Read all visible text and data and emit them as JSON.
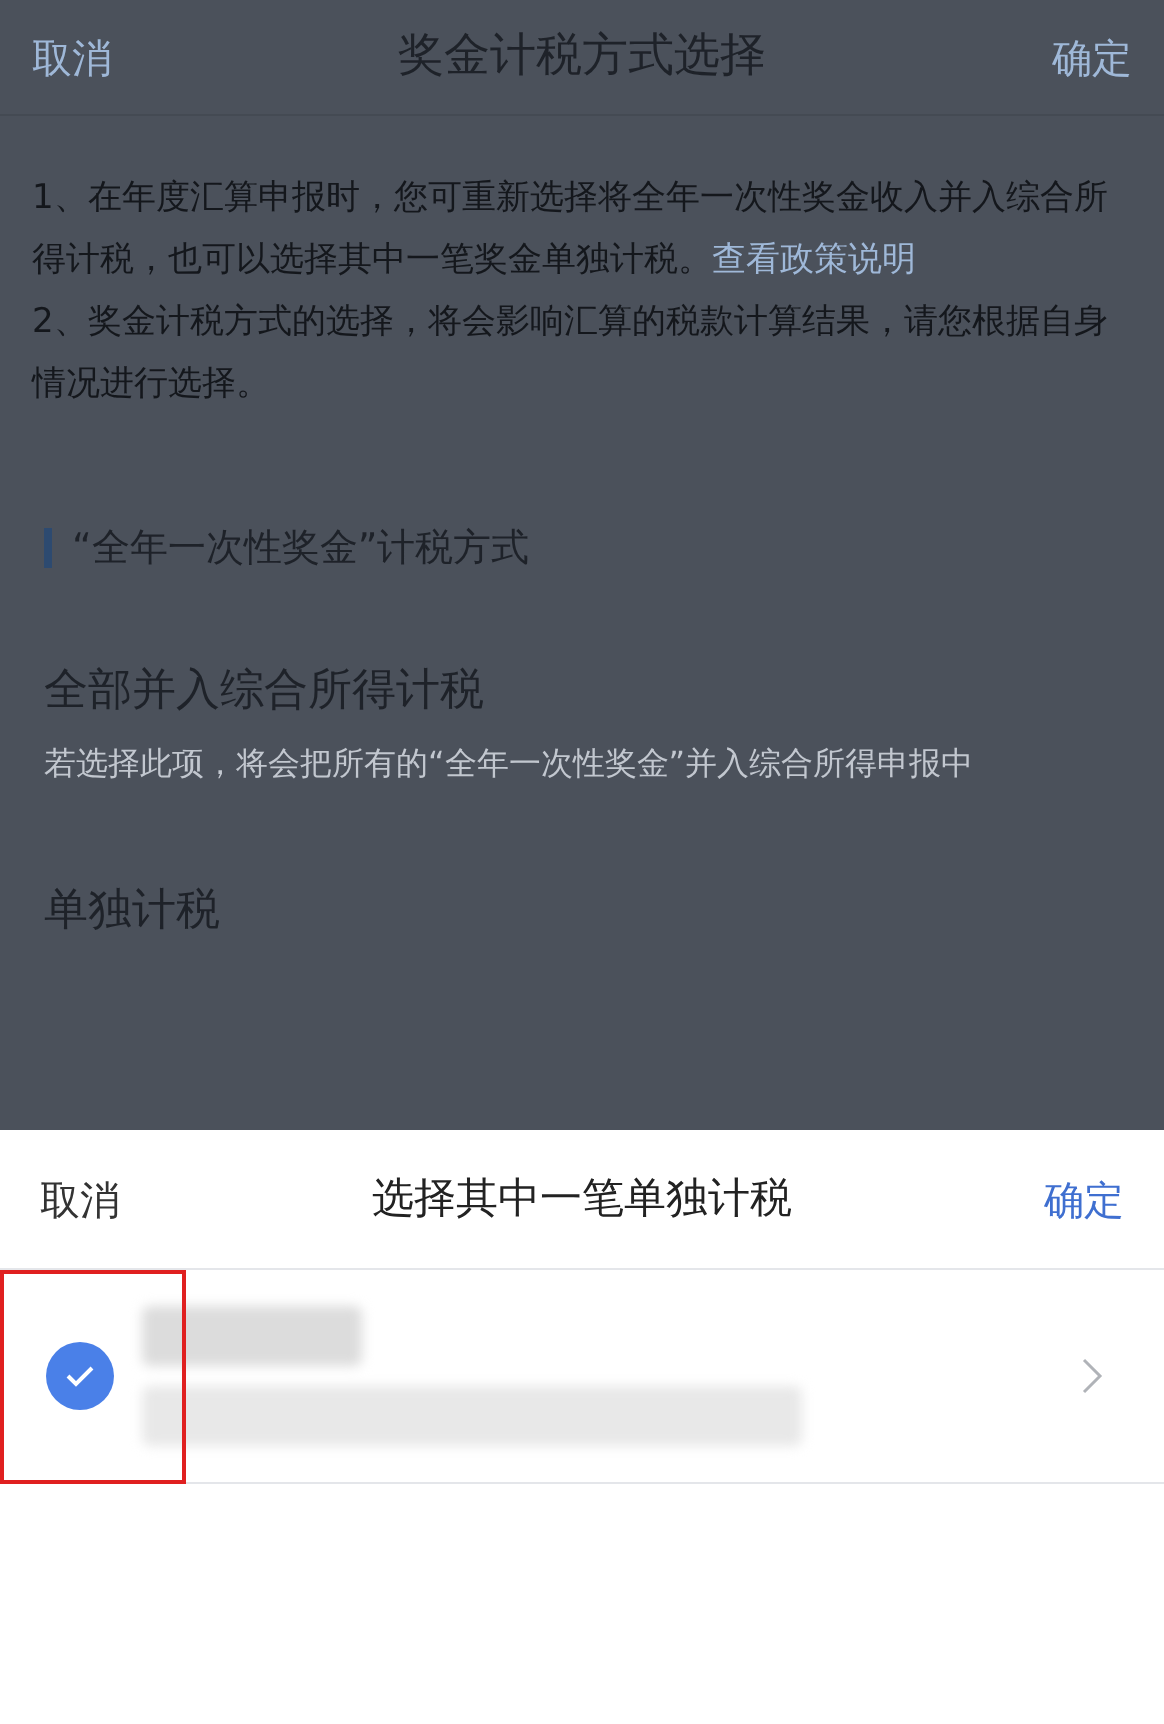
{
  "nav_bar": {
    "cancel": "取消",
    "title": "奖金计税方式选择",
    "confirm": "确定"
  },
  "notes": [
    {
      "text": "1、在年度汇算申报时，您可重新选择将全年一次性奖金收入并入综合所得计税，也可以选择其中一笔奖金单独计税。",
      "link": "查看政策说明"
    },
    {
      "text": "2、奖金计税方式的选择，将会影响汇算的税款计算结果，请您根据自身情况进行选择。"
    }
  ],
  "section_title": "“全年一次性奖金”计税方式",
  "options": [
    {
      "title": "全部并入综合所得计税",
      "description": "若选择此项，将会把所有的“全年一次性奖金”并入综合所得申报中"
    },
    {
      "title": "单独计税"
    }
  ],
  "sheet": {
    "cancel": "取消",
    "title": "选择其中一笔单独计税",
    "confirm": "确定",
    "rows": [
      {
        "selected": true,
        "highlighted": true
      }
    ]
  }
}
